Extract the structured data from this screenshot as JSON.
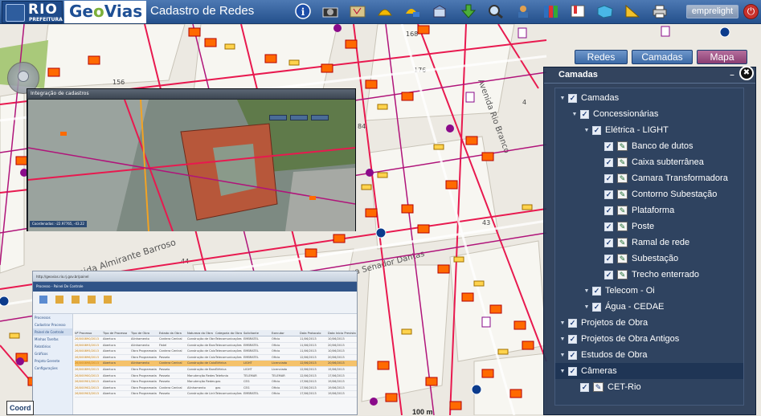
{
  "header": {
    "logo_main": "RIO",
    "logo_sub": "PREFEITURA",
    "brand": "GeoVias",
    "title": "Cadastro de Redes",
    "user": "emprelight"
  },
  "toolbar": {
    "icons": [
      "info-icon",
      "camera-icon",
      "map-book-icon",
      "hardhat-icon",
      "helmet-layers-icon",
      "open-box-icon",
      "download-arrow-icon",
      "map-search-icon",
      "worker-icon",
      "binders-icon",
      "bookmark-icon",
      "map-puzzle-icon",
      "triangle-ruler-icon",
      "printer-icon"
    ]
  },
  "modes": {
    "redes": "Redes",
    "camadas": "Camadas",
    "mapa": "Mapa"
  },
  "layers_panel": {
    "title": "Camadas",
    "items": [
      {
        "label": "Camadas",
        "level": 0,
        "arrow": true,
        "checked": true
      },
      {
        "label": "Concessionárias",
        "level": 1,
        "arrow": true,
        "checked": true
      },
      {
        "label": "Elétrica - LIGHT",
        "level": 2,
        "arrow": true,
        "checked": true
      },
      {
        "label": "Banco de dutos",
        "level": 3,
        "arrow": false,
        "checked": true,
        "icon": true
      },
      {
        "label": "Caixa subterrânea",
        "level": 3,
        "arrow": false,
        "checked": true,
        "icon": true
      },
      {
        "label": "Camara Transformadora",
        "level": 3,
        "arrow": false,
        "checked": true,
        "icon": true
      },
      {
        "label": "Contorno Subestação",
        "level": 3,
        "arrow": false,
        "checked": true,
        "icon": true
      },
      {
        "label": "Plataforma",
        "level": 3,
        "arrow": false,
        "checked": true,
        "icon": true
      },
      {
        "label": "Poste",
        "level": 3,
        "arrow": false,
        "checked": true,
        "icon": true
      },
      {
        "label": "Ramal de rede",
        "level": 3,
        "arrow": false,
        "checked": true,
        "icon": true
      },
      {
        "label": "Subestação",
        "level": 3,
        "arrow": false,
        "checked": true,
        "icon": true
      },
      {
        "label": "Trecho enterrado",
        "level": 3,
        "arrow": false,
        "checked": true,
        "icon": true
      },
      {
        "label": "Telecom - Oi",
        "level": 2,
        "arrow": true,
        "checked": true
      },
      {
        "label": "Água - CEDAE",
        "level": 2,
        "arrow": true,
        "checked": true
      },
      {
        "label": "Projetos de Obra",
        "level": 0,
        "arrow": true,
        "checked": true
      },
      {
        "label": "Projetos de Obra Antigos",
        "level": 0,
        "arrow": true,
        "checked": true
      },
      {
        "label": "Estudos de Obra",
        "level": 0,
        "arrow": true,
        "checked": true
      },
      {
        "label": "Câmeras",
        "level": 0,
        "arrow": true,
        "checked": true,
        "selected": true
      },
      {
        "label": "CET-Rio",
        "level": 1,
        "arrow": false,
        "checked": true,
        "icon": true,
        "cam": true
      }
    ]
  },
  "overlay_window": {
    "title": "Integração de cadastros",
    "footer": "Coordenadas: -22.97765, -43.22"
  },
  "spreadsheet_window": {
    "url": "http://geovias.rio.rj.gov.br/painel",
    "app": "Processo - Painel De Controle",
    "side_items": [
      "Processos",
      "Cadastrar Processo",
      "Painel de Controle",
      "Minhas Tarefas",
      "Relatórios",
      "Gráficos",
      "Projeto Gerente",
      "Configurações"
    ],
    "headers": [
      "Nº Processo",
      "Tipo de Processo",
      "Tipo de Obra",
      "Estado da Obra",
      "Natureza da Obra",
      "Categoria da Obra",
      "Solicitante",
      "Executor",
      "Data Protocolo",
      "Data Início Prevista"
    ],
    "rows": [
      [
        "26/000890/2013",
        "Abertura",
        "Alinhamento",
        "Cantera Central",
        "Construção de Obra",
        "Telecomunicações",
        "EMBRATEL",
        "Oficio",
        "11/06/2013",
        "10/06/2013"
      ],
      [
        "26/000893/2013",
        "Abertura",
        "Alinhamento",
        "Fistel",
        "Construção de Banco",
        "Telecomunicações",
        "EMBRATEL",
        "Oficio",
        "11/06/2013",
        "20/06/2013"
      ],
      [
        "26/000895/2013",
        "Abertura",
        "Obra Programada",
        "Cantera Central",
        "Construção de Caixa",
        "Telecomunicações",
        "EMBRATEL",
        "Oficio",
        "11/06/2013",
        "10/06/2013"
      ],
      [
        "26/000896/2013",
        "Abertura",
        "Obra Programada",
        "Passeio",
        "Construção de Caixa",
        "Telecomunicações",
        "EMBRATEL",
        "Oficio",
        "12/06/2013",
        "20/06/2013"
      ],
      [
        "26/000898/2013",
        "Abertura",
        "Alinhamento",
        "Cantera Central",
        "Construção de Caixa",
        "Elétrica",
        "LIGHT",
        "Licenciado",
        "12/06/2013",
        "20/06/2013"
      ],
      [
        "26/000899/2013",
        "Abertura",
        "Obra Programada",
        "Passeio",
        "Construção de Banco",
        "Elétrica",
        "LIGHT",
        "Licenciado",
        "12/06/2013",
        "15/06/2013"
      ],
      [
        "26/000900/2013",
        "Abertura",
        "Obra Programada",
        "Passeio",
        "Manutenção Redes",
        "Telefonia",
        "TELEMAR",
        "TELEMAR",
        "12/06/2013",
        "17/06/2013"
      ],
      [
        "26/000901/2013",
        "Abertura",
        "Obra Programada",
        "Passeio",
        "Manutenção Redes",
        "gas",
        "CEG",
        "Oficio",
        "17/06/2013",
        "19/06/2013"
      ],
      [
        "26/000902/2013",
        "Abertura",
        "Obra Programada",
        "Cantera Central",
        "Alinhamento",
        "gas",
        "CEG",
        "Oficio",
        "17/06/2013",
        "19/06/2013"
      ],
      [
        "26/000903/2013",
        "Abertura",
        "Obra Programada",
        "Passeio",
        "Construção de Linha",
        "Telecomunicações",
        "EMBRATEL",
        "Oficio",
        "17/06/2013",
        "19/06/2013"
      ]
    ]
  },
  "map": {
    "coord_label": "Coord",
    "scale_label": "100 m",
    "street_labels": [
      "Avenida Almirante Barroso",
      "Avenida Rio Branco",
      "Rua Senador Dantas"
    ],
    "numbers": [
      "168",
      "156",
      "176",
      "44",
      "84",
      "43",
      "4",
      "9",
      "8"
    ]
  }
}
